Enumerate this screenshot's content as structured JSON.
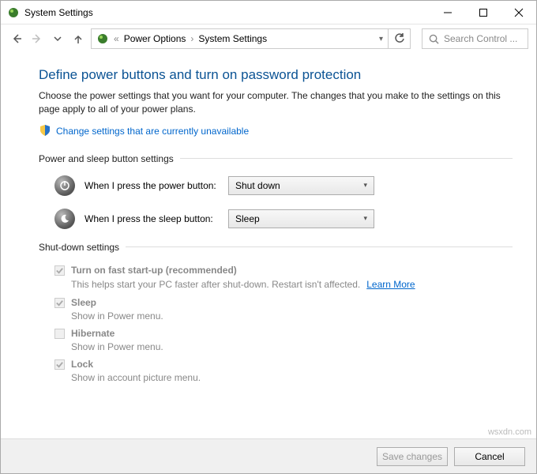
{
  "window": {
    "title": "System Settings"
  },
  "breadcrumb": {
    "sep1": "«",
    "item1": "Power Options",
    "sep2": "›",
    "item2": "System Settings"
  },
  "search": {
    "placeholder": "Search Control ..."
  },
  "page": {
    "title": "Define power buttons and turn on password protection",
    "desc": "Choose the power settings that you want for your computer. The changes that you make to the settings on this page apply to all of your power plans.",
    "change_link": "Change settings that are currently unavailable"
  },
  "power_section": {
    "header": "Power and sleep button settings",
    "power_label": "When I press the power button:",
    "power_value": "Shut down",
    "sleep_label": "When I press the sleep button:",
    "sleep_value": "Sleep"
  },
  "shutdown_section": {
    "header": "Shut-down settings",
    "items": [
      {
        "title": "Turn on fast start-up (recommended)",
        "desc": "This helps start your PC faster after shut-down. Restart isn't affected. ",
        "learn_more": "Learn More",
        "checked": true
      },
      {
        "title": "Sleep",
        "desc": "Show in Power menu.",
        "checked": true
      },
      {
        "title": "Hibernate",
        "desc": "Show in Power menu.",
        "checked": false
      },
      {
        "title": "Lock",
        "desc": "Show in account picture menu.",
        "checked": true
      }
    ]
  },
  "footer": {
    "save": "Save changes",
    "cancel": "Cancel"
  },
  "watermark": "wsxdn.com"
}
